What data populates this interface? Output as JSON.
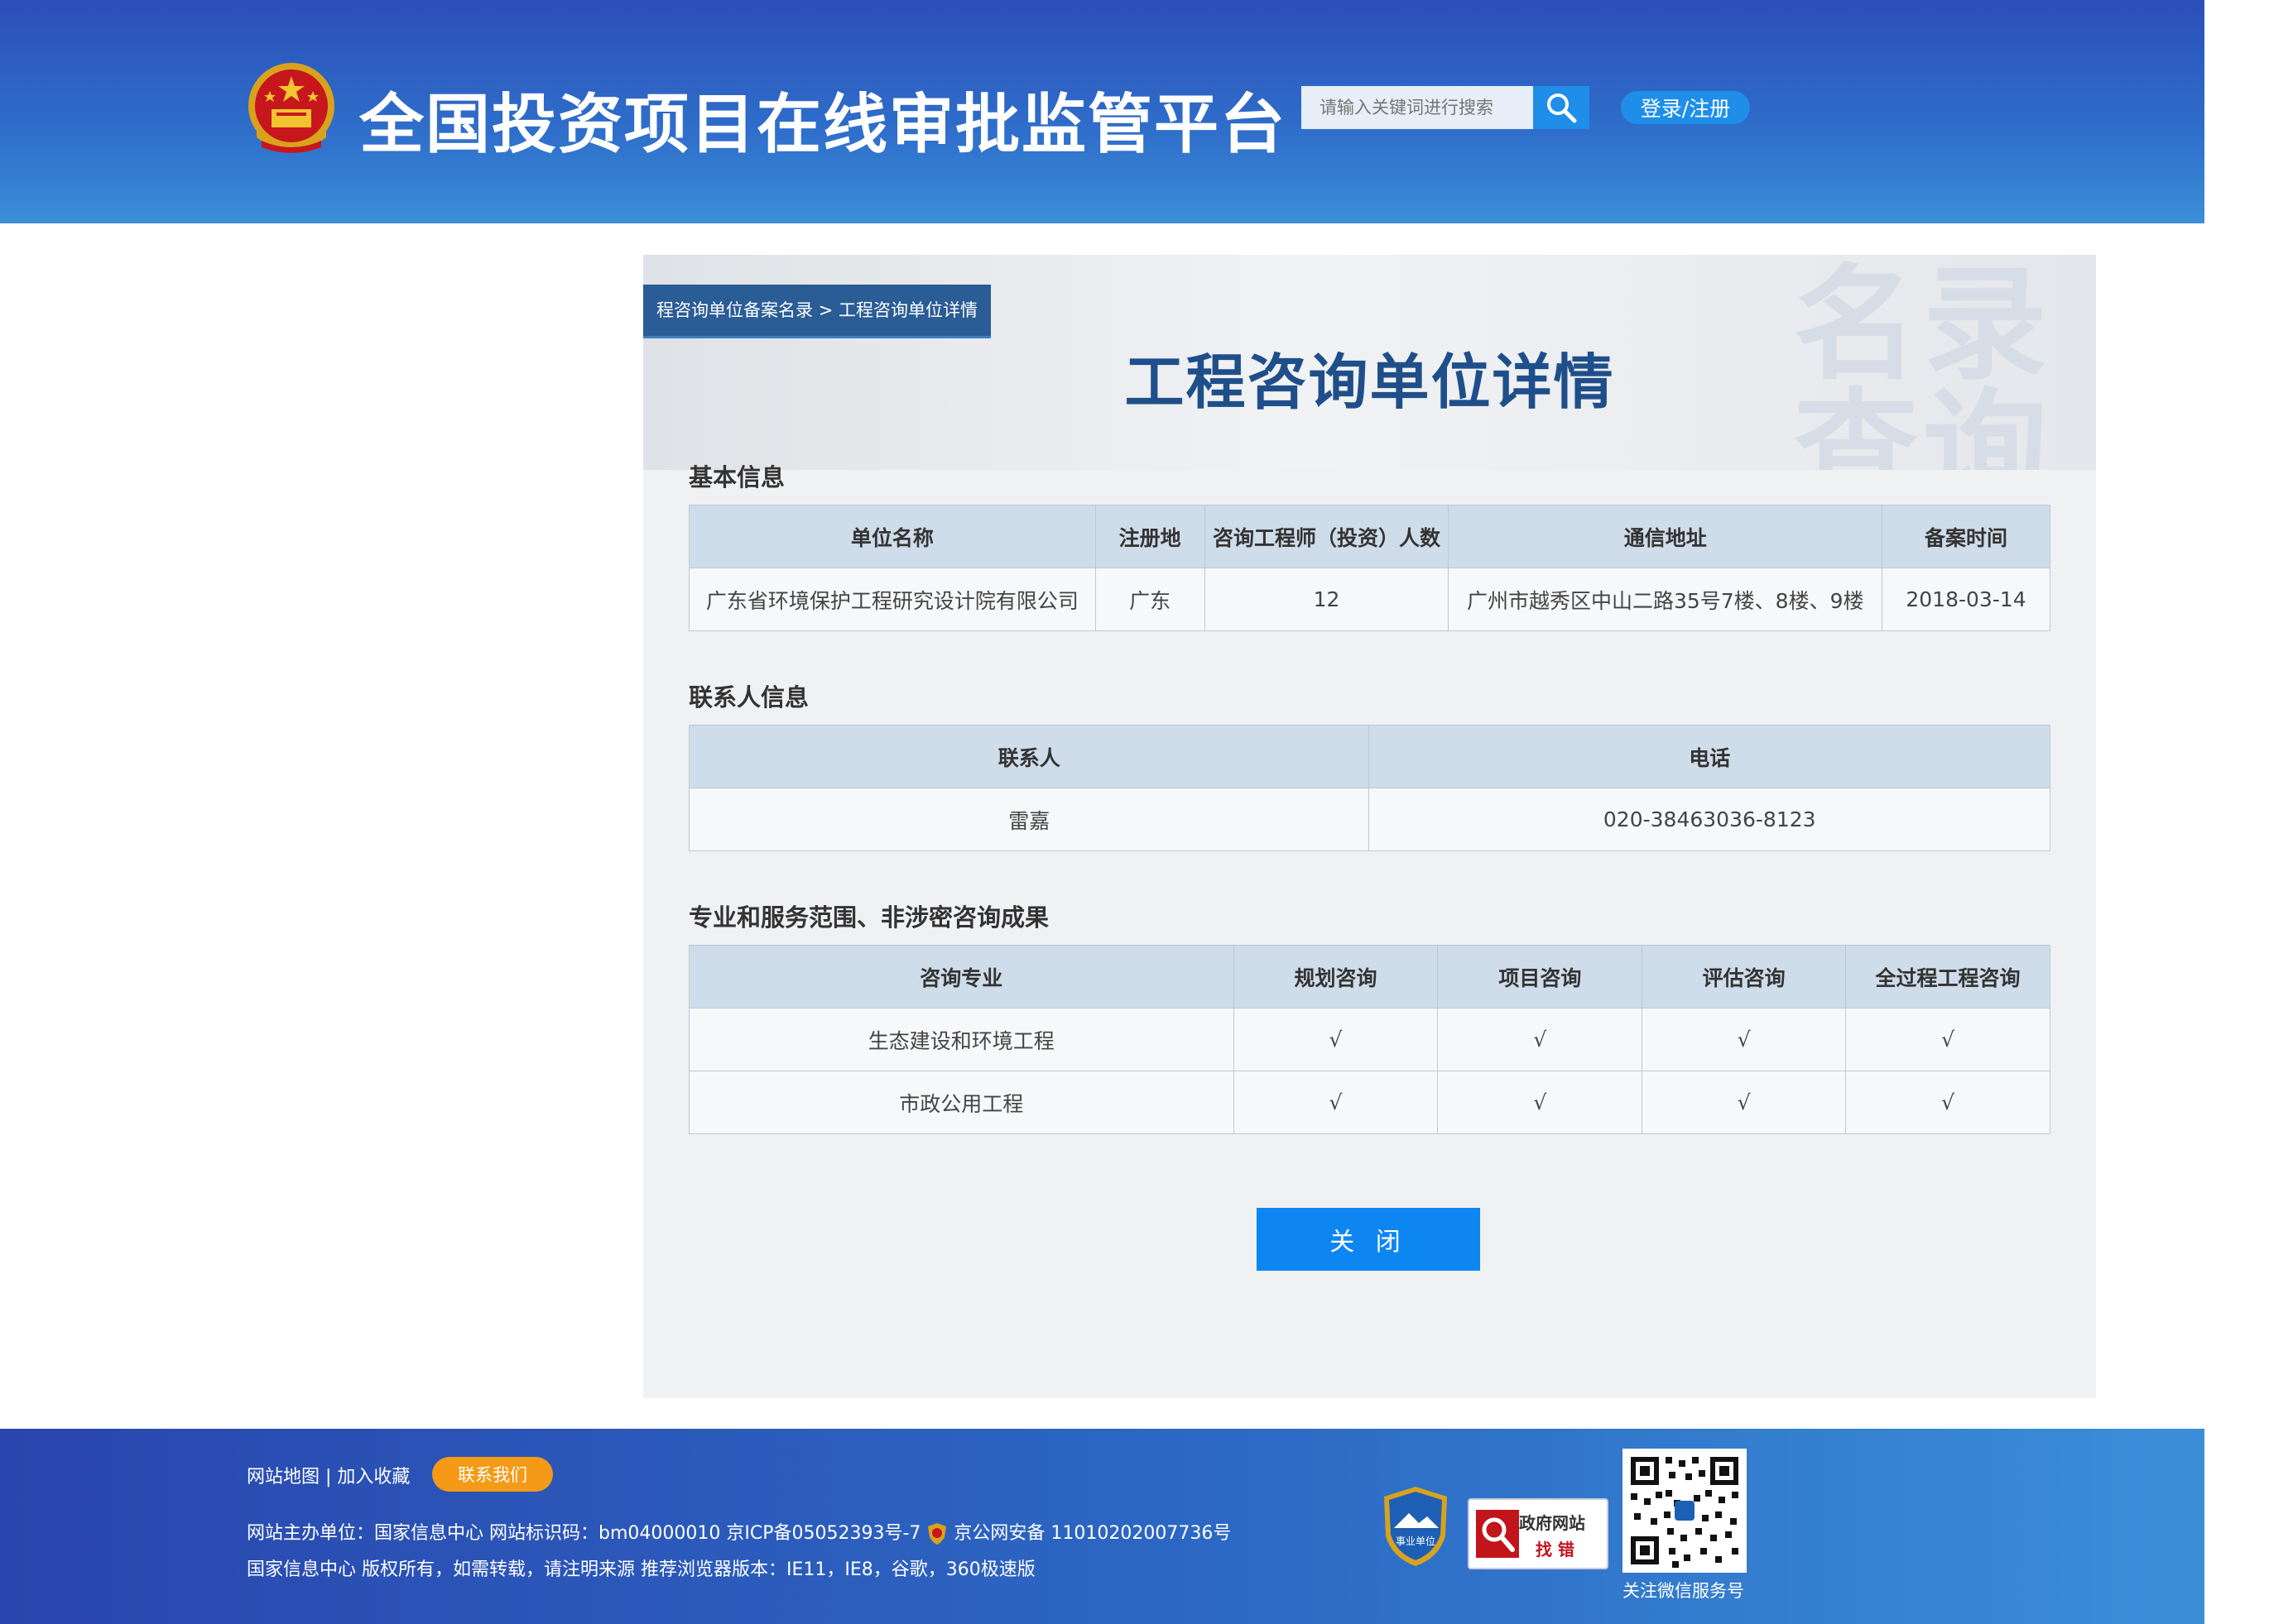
{
  "header": {
    "title": "全国投资项目在线审批监管平台",
    "search_placeholder": "请输入关键词进行搜索",
    "login_label": "登录/注册"
  },
  "breadcrumb": {
    "parent": "程咨询单位备案名录",
    "separator": ">",
    "current": "工程咨询单位详情"
  },
  "banner": {
    "title": "工程咨询单位详情",
    "watermark_line1": "名录",
    "watermark_line2": "查询"
  },
  "basic_info": {
    "section_title": "基本信息",
    "headers": [
      "单位名称",
      "注册地",
      "咨询工程师（投资）人数",
      "通信地址",
      "备案时间"
    ],
    "row": [
      "广东省环境保护工程研究设计院有限公司",
      "广东",
      "12",
      "广州市越秀区中山二路35号7楼、8楼、9楼",
      "2018-03-14"
    ]
  },
  "contact_info": {
    "section_title": "联系人信息",
    "headers": [
      "联系人",
      "电话"
    ],
    "row": [
      "雷嘉",
      "020-38463036-8123"
    ]
  },
  "scope": {
    "section_title": "专业和服务范围、非涉密咨询成果",
    "headers": [
      "咨询专业",
      "规划咨询",
      "项目咨询",
      "评估咨询",
      "全过程工程咨询"
    ],
    "rows": [
      [
        "生态建设和环境工程",
        "√",
        "√",
        "√",
        "√"
      ],
      [
        "市政公用工程",
        "√",
        "√",
        "√",
        "√"
      ]
    ]
  },
  "close_label": "关 闭",
  "footer": {
    "links": "网站地图 | 加入收藏",
    "contact_label": "联系我们",
    "line1": "网站主办单位：国家信息中心   网站标识码：bm04000010   京ICP备05052393号-7",
    "line1_police": "京公网安备 11010202007736号",
    "line2": "国家信息中心 版权所有，如需转载，请注明来源   推荐浏览器版本：IE11，IE8，谷歌，360极速版",
    "badge_shield_text": "事业单位",
    "gov_badge_line1": "政府网站",
    "gov_badge_line2": "找 错",
    "qr_label": "关注微信服务号"
  },
  "colors": {
    "header_blue": "#2b4fb8",
    "accent_blue": "#1e8ee9",
    "title_blue": "#1f4f8a",
    "contact_orange": "#f59a17"
  }
}
